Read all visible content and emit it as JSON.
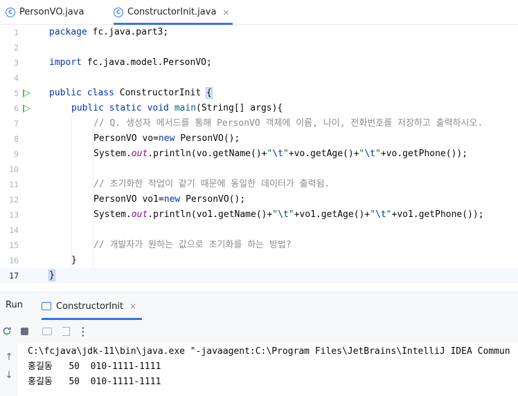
{
  "tabs": [
    {
      "label": "PersonVO.java",
      "icon": "class-icon"
    },
    {
      "label": "ConstructorInit.java",
      "icon": "class-icon",
      "close": "×"
    }
  ],
  "editor": {
    "line_numbers": [
      "1",
      "2",
      "3",
      "4",
      "5",
      "6",
      "7",
      "8",
      "9",
      "10",
      "11",
      "12",
      "13",
      "14",
      "15",
      "16",
      "17"
    ],
    "current_line": "17",
    "code": {
      "l1_kw": "package",
      "l1_rest": " fc.java.part3;",
      "l3_kw": "import",
      "l3_rest": " fc.java.model.PersonVO;",
      "l5_kw": "public class",
      "l5_name": " ConstructorInit ",
      "l5_brace": "{",
      "l6_kw": "public static void",
      "l6_name": "main",
      "l6_rest": "(String[] args){",
      "l7_comment": "// Q. 생성자 메서드를 통해 PersonVO 객체에 이름, 나이, 전화번호를 저장하고 출력하시오.",
      "l8_a": "PersonVO vo=",
      "l8_kw": "new",
      "l8_b": " PersonVO();",
      "l9_a": "System.",
      "l9_field": "out",
      "l9_b": ".println(vo.getName()+",
      "l9_s1q": "\"",
      "l9_s1e": "\\t",
      "l9_s1q2": "\"",
      "l9_c": "+vo.getAge()+",
      "l9_s2q": "\"",
      "l9_s2e": "\\t",
      "l9_s2q2": "\"",
      "l9_d": "+vo.getPhone());",
      "l11_comment": "// 초기화한 작업이 같기 때문에 동일한 데이터가 출력됨.",
      "l12_a": "PersonVO vo1=",
      "l12_kw": "new",
      "l12_b": " PersonVO();",
      "l13_a": "System.",
      "l13_field": "out",
      "l13_b": ".println(vo1.getName()+",
      "l13_s1q": "\"",
      "l13_s1e": "\\t",
      "l13_s1q2": "\"",
      "l13_c": "+vo1.getAge()+",
      "l13_s2q": "\"",
      "l13_s2e": "\\t",
      "l13_s2q2": "\"",
      "l13_d": "+vo1.getPhone());",
      "l15_comment": "// 개발자가 원하는 값으로 초기화를 하는 방법?",
      "l16_brace": "}",
      "l17_brace": "}"
    }
  },
  "run_panel": {
    "label": "Run",
    "tab_label": "ConstructorInit",
    "tab_close": "×",
    "toolbar_icons": [
      "rerun-icon",
      "stop-icon",
      "screenshot-icon",
      "exit-icon",
      "more-icon"
    ],
    "more_glyph": "⋮",
    "scroll_up": "↑",
    "scroll_down": "↓",
    "output": [
      "C:\\fcjava\\jdk-11\\bin\\java.exe \"-javaagent:C:\\Program Files\\JetBrains\\IntelliJ IDEA Commun",
      "홍길동   50  010-1111-1111",
      "홍길동   50  010-1111-1111"
    ]
  },
  "colors": {
    "accent": "#3574f0",
    "keyword": "#0033b3",
    "string": "#067d17",
    "comment": "#8c8c8c",
    "run_gutter": "#5fb865"
  }
}
